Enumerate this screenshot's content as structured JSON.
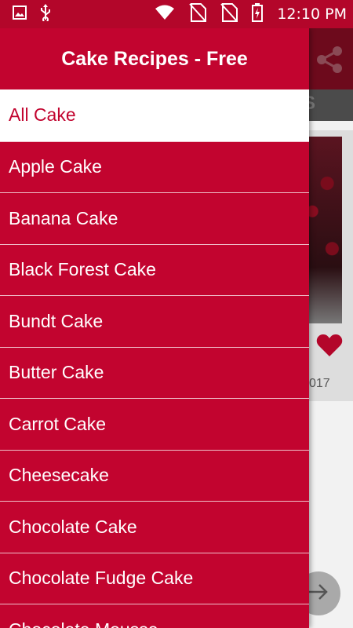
{
  "status_bar": {
    "time": "12:10 PM",
    "icons": [
      "image-icon",
      "usb-icon",
      "wifi-icon",
      "no-sim-icon",
      "no-sim-icon",
      "battery-charging-icon"
    ]
  },
  "drawer": {
    "title": "Cake Recipes - Free",
    "items": [
      {
        "label": "All Cake",
        "selected": true
      },
      {
        "label": "Apple Cake",
        "selected": false
      },
      {
        "label": "Banana Cake",
        "selected": false
      },
      {
        "label": "Black Forest Cake",
        "selected": false
      },
      {
        "label": "Bundt Cake",
        "selected": false
      },
      {
        "label": "Butter Cake",
        "selected": false
      },
      {
        "label": "Carrot Cake",
        "selected": false
      },
      {
        "label": "Cheesecake",
        "selected": false
      },
      {
        "label": "Chocolate Cake",
        "selected": false
      },
      {
        "label": "Chocolate Fudge Cake",
        "selected": false
      },
      {
        "label": "Chocolate Mousse",
        "selected": false
      }
    ]
  },
  "background": {
    "tab_partial": "S",
    "date_partial": "017"
  },
  "colors": {
    "primary": "#c2042f",
    "status_bar": "#b3062a",
    "selected_item_bg": "#ffffff",
    "heart": "#b3062a"
  }
}
